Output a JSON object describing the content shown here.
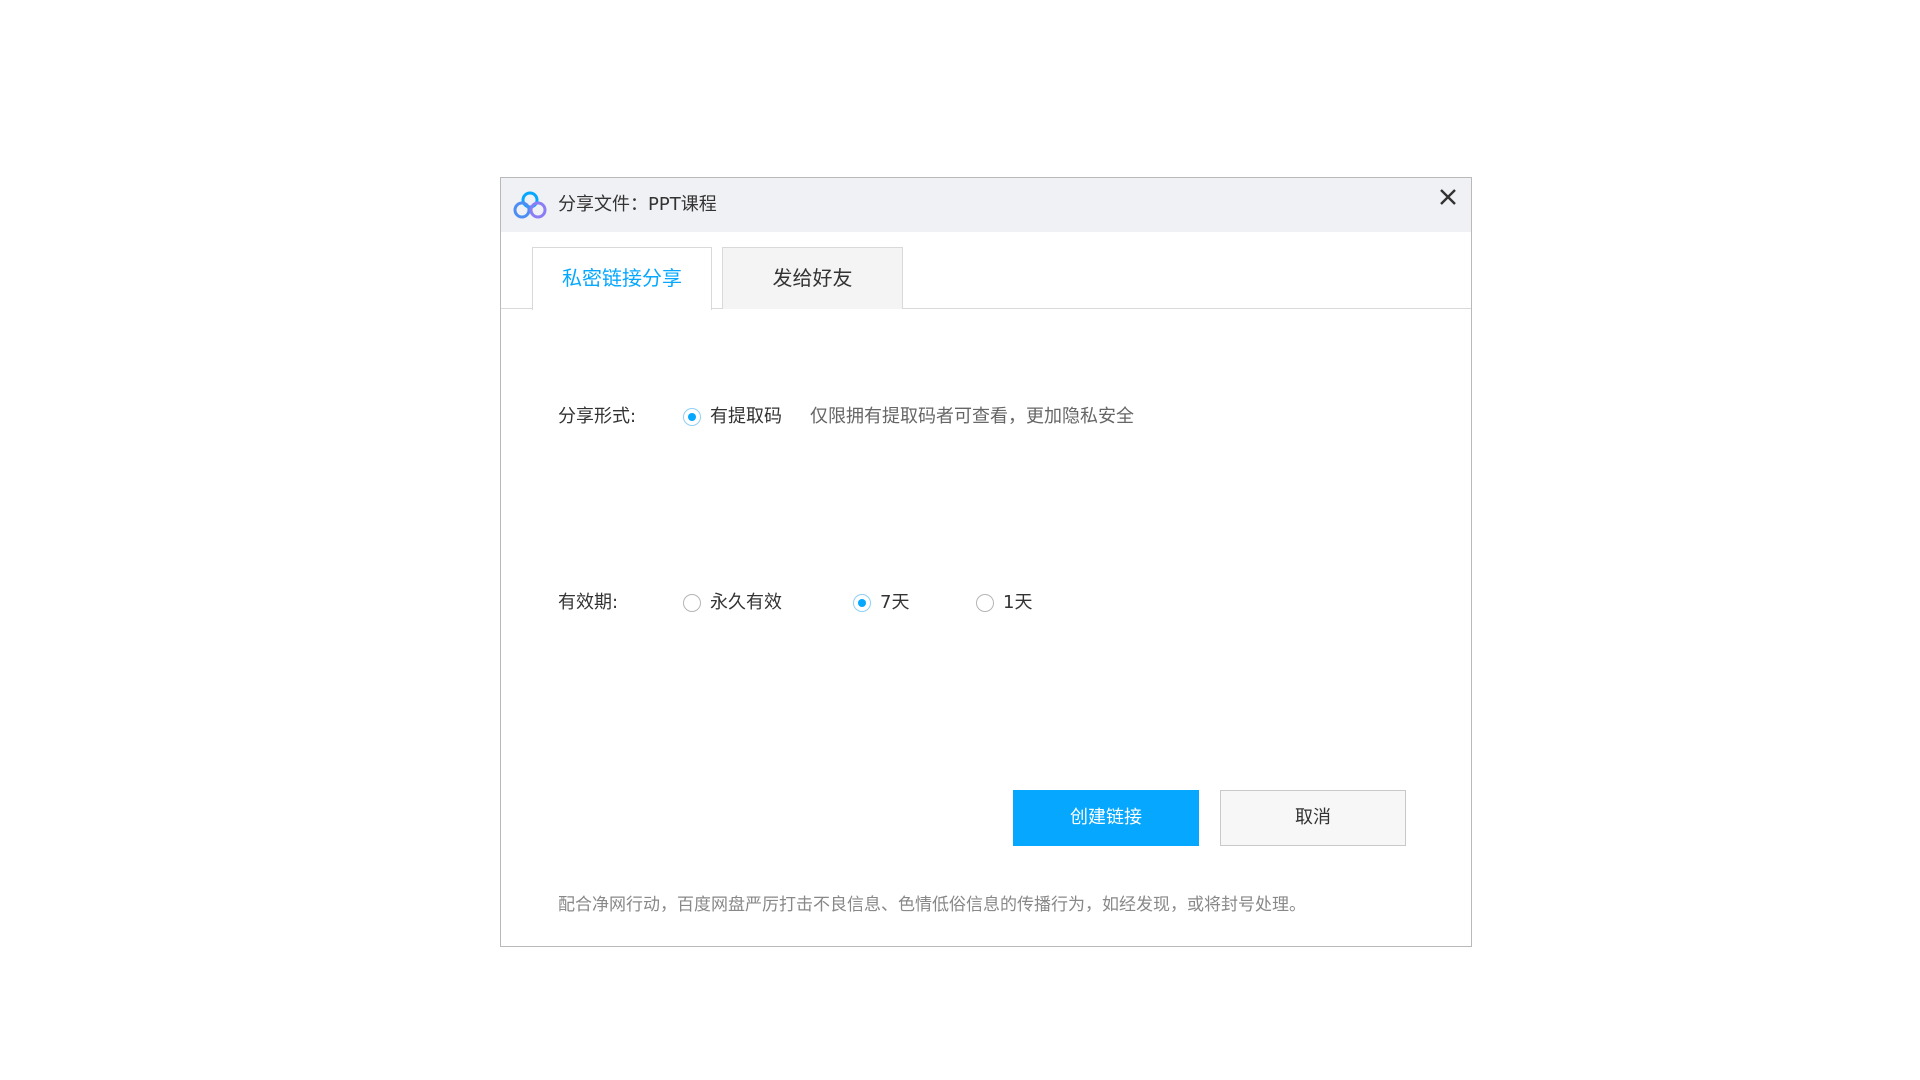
{
  "dialog": {
    "title": "分享文件：PPT课程",
    "app_logo_icon": "baidu-netdisk-logo-icon",
    "close_icon": "close-icon"
  },
  "tabs": [
    {
      "label": "私密链接分享",
      "active": true
    },
    {
      "label": "发给好友",
      "active": false
    }
  ],
  "share_form": {
    "label": "分享形式:",
    "options": [
      {
        "label": "有提取码",
        "checked": true
      }
    ],
    "hint": "仅限拥有提取码者可查看，更加隐私安全"
  },
  "validity": {
    "label": "有效期:",
    "options": [
      {
        "label": "永久有效",
        "checked": false
      },
      {
        "label": "7天",
        "checked": true
      },
      {
        "label": "1天",
        "checked": false
      }
    ]
  },
  "buttons": {
    "create_label": "创建链接",
    "cancel_label": "取消"
  },
  "notice": "配合净网行动，百度网盘严厉打击不良信息、色情低俗信息的传播行为，如经发现，或将封号处理。",
  "colors": {
    "accent": "#06a7ff",
    "titlebar_bg": "#f0f1f4"
  }
}
